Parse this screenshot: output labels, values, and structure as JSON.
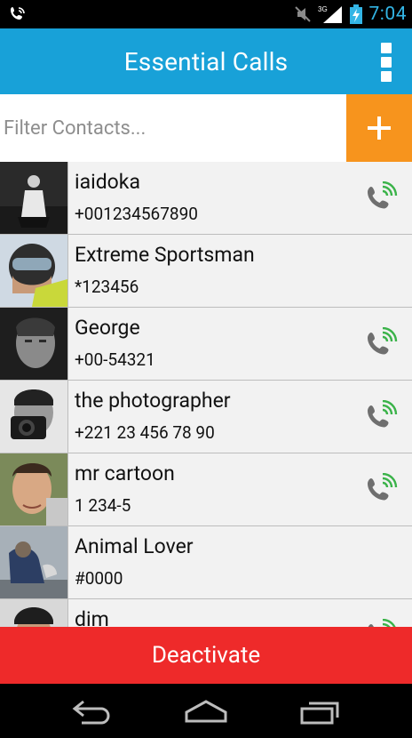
{
  "status": {
    "time": "7:04",
    "network": "3G"
  },
  "app": {
    "title": "Essential Calls"
  },
  "filter": {
    "placeholder": "Filter Contacts..."
  },
  "contacts": [
    {
      "name": "iaidoka",
      "number": "+001234567890",
      "call_icon": true
    },
    {
      "name": "Extreme Sportsman",
      "number": "*123456",
      "call_icon": false
    },
    {
      "name": "George",
      "number": "+00-54321",
      "call_icon": true
    },
    {
      "name": "the photographer",
      "number": "+221 23 456 78 90",
      "call_icon": true
    },
    {
      "name": "mr cartoon",
      "number": "1 234-5",
      "call_icon": true
    },
    {
      "name": "Animal Lover",
      "number": "#0000",
      "call_icon": false
    },
    {
      "name": "dim",
      "number": "",
      "call_icon": true
    }
  ],
  "actions": {
    "deactivate_label": "Deactivate"
  },
  "colors": {
    "appbar": "#18a1d8",
    "add_button": "#f7941d",
    "deactivate": "#ee2a2a",
    "call_icon_green": "#3bb34a"
  }
}
